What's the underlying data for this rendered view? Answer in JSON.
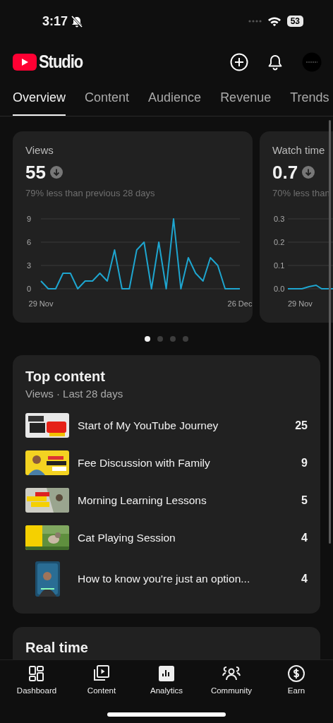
{
  "status_bar": {
    "time": "3:17",
    "battery": "53"
  },
  "header": {
    "logo_text": "Studio"
  },
  "tabs": [
    {
      "label": "Overview",
      "selected": true
    },
    {
      "label": "Content",
      "selected": false
    },
    {
      "label": "Audience",
      "selected": false
    },
    {
      "label": "Revenue",
      "selected": false
    },
    {
      "label": "Trends",
      "selected": false
    }
  ],
  "metric_cards": [
    {
      "title": "Views",
      "value": "55",
      "comparison": "79% less than previous 28 days",
      "chart_data": {
        "type": "line",
        "categories": [
          "29 Nov",
          null,
          null,
          null,
          null,
          null,
          null,
          null,
          null,
          null,
          null,
          null,
          null,
          null,
          null,
          null,
          null,
          null,
          null,
          null,
          null,
          null,
          null,
          null,
          null,
          null,
          null,
          "26 Dec"
        ],
        "ylim": [
          0,
          9
        ],
        "yticks": [
          0,
          3,
          6,
          9
        ],
        "series": [
          {
            "color": "#1ea5cf",
            "values": [
              1,
              0,
              0,
              2,
              2,
              0,
              1,
              1,
              2,
              1,
              5,
              0,
              0,
              5,
              6,
              0,
              6,
              0,
              9,
              0,
              4,
              2,
              1,
              4,
              3,
              0,
              0,
              0
            ]
          }
        ]
      }
    },
    {
      "title": "Watch time",
      "value": "0.7",
      "comparison": "70% less than",
      "y_axis_labels": [
        "0.3",
        "0.2",
        "0.1",
        "0.0"
      ],
      "x_axis_label": "29 Nov"
    }
  ],
  "carousel_dots": [
    {
      "selected": true
    },
    {
      "selected": false
    },
    {
      "selected": false
    },
    {
      "selected": false
    }
  ],
  "top_content": {
    "title": "Top content",
    "subtitle": "Views · Last 28 days",
    "items": [
      {
        "title": "Start of My YouTube Journey",
        "views": "25",
        "kind": "wide"
      },
      {
        "title": "Fee Discussion with Family",
        "views": "9",
        "kind": "wide"
      },
      {
        "title": "Morning Learning Lessons",
        "views": "5",
        "kind": "wide"
      },
      {
        "title": "Cat Playing Session",
        "views": "4",
        "kind": "wide"
      },
      {
        "title": "How to know you're just an option...",
        "views": "4",
        "kind": "short"
      }
    ]
  },
  "real_time": {
    "title": "Real time"
  },
  "bottom_nav": [
    {
      "label": "Dashboard",
      "kind": "dashboard",
      "selected": false
    },
    {
      "label": "Content",
      "kind": "content",
      "selected": false
    },
    {
      "label": "Analytics",
      "kind": "analytics",
      "selected": true
    },
    {
      "label": "Community",
      "kind": "community",
      "selected": false
    },
    {
      "label": "Earn",
      "kind": "earn",
      "selected": false
    }
  ]
}
